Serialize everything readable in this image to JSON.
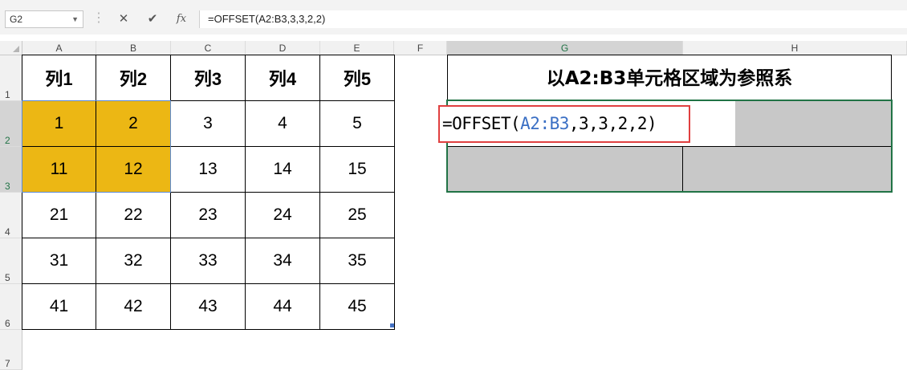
{
  "formula_bar": {
    "name_box": "G2",
    "cancel_icon": "✕",
    "enter_icon": "✔",
    "fx_label": "fx",
    "formula": "=OFFSET(A2:B3,3,3,2,2)"
  },
  "columns": [
    "A",
    "B",
    "C",
    "D",
    "E",
    "F",
    "G",
    "H"
  ],
  "rows": [
    "1",
    "2",
    "3",
    "4",
    "5",
    "6",
    "7"
  ],
  "table": {
    "headers": [
      "列1",
      "列2",
      "列3",
      "列4",
      "列5"
    ],
    "rows": [
      [
        "1",
        "2",
        "3",
        "4",
        "5"
      ],
      [
        "11",
        "12",
        "13",
        "14",
        "15"
      ],
      [
        "21",
        "22",
        "23",
        "24",
        "25"
      ],
      [
        "31",
        "32",
        "33",
        "34",
        "35"
      ],
      [
        "41",
        "42",
        "43",
        "44",
        "45"
      ]
    ]
  },
  "offset_block": {
    "title": "以A2:B3单元格区域为参照系",
    "formula_parts": [
      "=OFFSET(",
      "A2:B3",
      ",3,3,2,2)"
    ]
  },
  "colors": {
    "highlight_fill": "#ecb714",
    "result_fill": "#c8c8c8",
    "formula_box_border": "#e04040",
    "reference_text": "#3a6fc4",
    "selection_border": "#217346"
  }
}
